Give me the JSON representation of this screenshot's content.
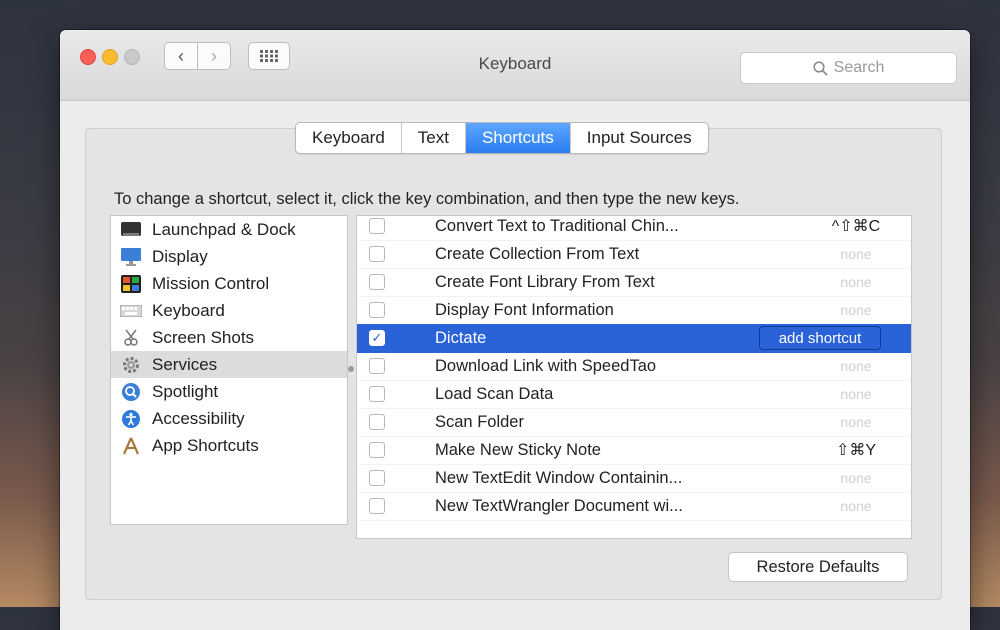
{
  "window": {
    "title": "Keyboard"
  },
  "toolbar": {
    "back_icon": "chevron-left-icon",
    "forward_icon": "chevron-right-icon",
    "grid_icon": "show-all-grid-icon",
    "search_placeholder": "Search"
  },
  "tabs": [
    {
      "label": "Keyboard",
      "active": false
    },
    {
      "label": "Text",
      "active": false
    },
    {
      "label": "Shortcuts",
      "active": true
    },
    {
      "label": "Input Sources",
      "active": false
    }
  ],
  "instruction": "To change a shortcut, select it, click the key combination, and then type the new keys.",
  "sidebar": {
    "items": [
      {
        "label": "Launchpad & Dock",
        "icon": "launchpad-dock-icon"
      },
      {
        "label": "Display",
        "icon": "display-icon"
      },
      {
        "label": "Mission Control",
        "icon": "mission-control-icon"
      },
      {
        "label": "Keyboard",
        "icon": "keyboard-icon"
      },
      {
        "label": "Screen Shots",
        "icon": "screenshot-icon"
      },
      {
        "label": "Services",
        "icon": "gear-icon",
        "selected": true
      },
      {
        "label": "Spotlight",
        "icon": "spotlight-icon"
      },
      {
        "label": "Accessibility",
        "icon": "accessibility-icon"
      },
      {
        "label": "App Shortcuts",
        "icon": "app-shortcuts-icon"
      }
    ]
  },
  "services": [
    {
      "label": "Convert Text to Traditional Chin...",
      "shortcut": "^⇧⌘C",
      "checked": false
    },
    {
      "label": "Create Collection From Text",
      "shortcut": "none",
      "checked": false
    },
    {
      "label": "Create Font Library From Text",
      "shortcut": "none",
      "checked": false
    },
    {
      "label": "Display Font Information",
      "shortcut": "none",
      "checked": false
    },
    {
      "label": "Dictate",
      "shortcut": "add shortcut",
      "checked": true,
      "selected": true
    },
    {
      "label": "Download Link with SpeedTao",
      "shortcut": "none",
      "checked": false
    },
    {
      "label": "Load Scan Data",
      "shortcut": "none",
      "checked": false
    },
    {
      "label": "Scan Folder",
      "shortcut": "none",
      "checked": false
    },
    {
      "label": "Make New Sticky Note",
      "shortcut": "⇧⌘Y",
      "checked": false
    },
    {
      "label": "New TextEdit Window Containin...",
      "shortcut": "none",
      "checked": false
    },
    {
      "label": "New TextWrangler Document wi...",
      "shortcut": "none",
      "checked": false
    }
  ],
  "buttons": {
    "restore_defaults": "Restore Defaults"
  },
  "colors": {
    "accent": "#2a63d8",
    "tab_active": "#3a8bf5"
  }
}
